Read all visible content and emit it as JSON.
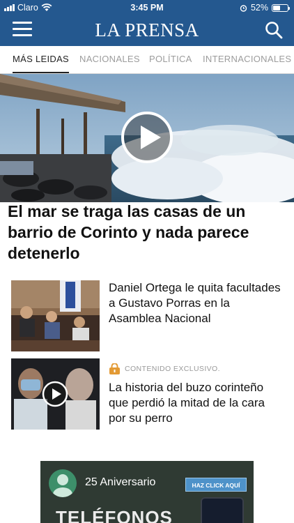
{
  "status_bar": {
    "carrier": "Claro",
    "time": "3:45 PM",
    "battery": "52%",
    "battery_level": 0.52
  },
  "header": {
    "logo": "LA PRENSA",
    "menu_icon": "hamburger-menu-icon",
    "search_icon": "search-icon",
    "brand_color": "#24588f"
  },
  "tabs": [
    {
      "label": "MÁS LEIDAS",
      "active": true
    },
    {
      "label": "NACIONALES",
      "active": false
    },
    {
      "label": "POLÍTICA",
      "active": false
    },
    {
      "label": "INTERNACIONALES",
      "active": false
    }
  ],
  "hero": {
    "title": "El mar se traga las casas de un barrio de Corinto y nada parece detenerlo",
    "has_video": true
  },
  "articles": [
    {
      "title": "Daniel Ortega le quita facultades a Gustavo Porras en la Asamblea Nacional",
      "exclusive_label": "",
      "has_video": false
    },
    {
      "title": "La historia del buzo corinteño que perdió la mitad de la cara por su perro",
      "exclusive_label": "CONTENIDO EXCLUSIVO.",
      "has_video": true
    }
  ],
  "ad": {
    "anniversary": "25 Aniversario",
    "cta": "HAZ CLICK AQUÍ",
    "headline": "TELÉFONOS"
  }
}
